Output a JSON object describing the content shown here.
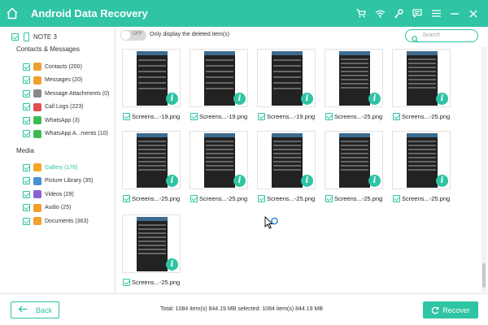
{
  "app": {
    "title": "Android Data Recovery"
  },
  "titlebar": {
    "icons": [
      "cart-icon",
      "wifi-icon",
      "key-icon",
      "feedback-icon",
      "menu-icon",
      "minimize-icon",
      "close-icon"
    ]
  },
  "device": {
    "name": "NOTE 3"
  },
  "sidebar": {
    "sections": [
      {
        "title": "Contacts & Messages",
        "items": [
          {
            "label": "Contacts (200)",
            "icon": "contacts-icon",
            "color": "#f0a030"
          },
          {
            "label": "Messages (20)",
            "icon": "messages-icon",
            "color": "#f0a030"
          },
          {
            "label": "Message Attachments (0)",
            "icon": "attachment-icon",
            "color": "#888888"
          },
          {
            "label": "Call Logs (223)",
            "icon": "call-logs-icon",
            "color": "#e05050"
          },
          {
            "label": "WhatsApp (3)",
            "icon": "whatsapp-icon",
            "color": "#3cba54"
          },
          {
            "label": "WhatsApp A...ments (10)",
            "icon": "whatsapp-attachments-icon",
            "color": "#3cba54"
          }
        ]
      },
      {
        "title": "Media",
        "items": [
          {
            "label": "Gallery (176)",
            "icon": "gallery-icon",
            "color": "#f5a623",
            "active": true
          },
          {
            "label": "Picture Library (35)",
            "icon": "picture-library-icon",
            "color": "#4a8fd8"
          },
          {
            "label": "Videos (29)",
            "icon": "videos-icon",
            "color": "#8a63d2"
          },
          {
            "label": "Audio (25)",
            "icon": "audio-icon",
            "color": "#f0a030"
          },
          {
            "label": "Documents (363)",
            "icon": "documents-icon",
            "color": "#f0a030"
          }
        ]
      }
    ]
  },
  "filter": {
    "toggle_text": "OFF",
    "label": "Only display the deleted item(s)"
  },
  "search": {
    "placeholder": "Search"
  },
  "files": [
    {
      "name": "Screens...-19.png"
    },
    {
      "name": "Screens...-19.png"
    },
    {
      "name": "Screens...-19.png"
    },
    {
      "name": "Screens...-25.png"
    },
    {
      "name": "Screens...-25.png"
    },
    {
      "name": "Screens...-25.png"
    },
    {
      "name": "Screens...-25.png"
    },
    {
      "name": "Screens...-25.png"
    },
    {
      "name": "Screens...-25.png"
    },
    {
      "name": "Screens...-25.png"
    },
    {
      "name": "Screens...-25.png"
    }
  ],
  "footer": {
    "back_label": "Back",
    "summary": "Total: 1084 item(s) 844.19 MB  selected: 1084 item(s) 844.19 MB",
    "recover_label": "Recover"
  },
  "colors": {
    "accent": "#2ec4a4"
  }
}
